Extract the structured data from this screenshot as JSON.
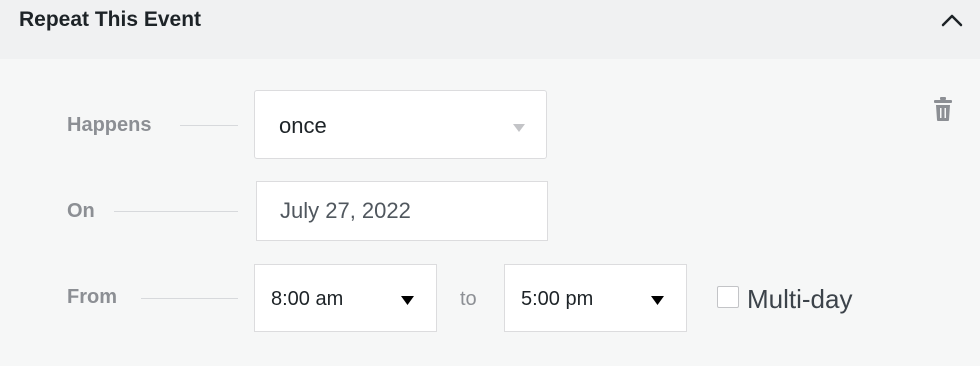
{
  "section": {
    "title": "Repeat This Event",
    "collapse_icon": "chevron-up-icon"
  },
  "rows": {
    "happens": {
      "label": "Happens",
      "value": "once"
    },
    "on": {
      "label": "On",
      "value": "July 27, 2022"
    },
    "from": {
      "label": "From",
      "start_time": "8:00 am",
      "to_label": "to",
      "end_time": "5:00 pm",
      "multiday_label": "Multi-day",
      "multiday_checked": false
    }
  },
  "actions": {
    "delete_icon": "trash-icon"
  },
  "colors": {
    "header_bg": "#f0f1f2",
    "panel_bg": "#f6f7f7",
    "label": "#8c8f94",
    "text": "#1d2327"
  }
}
